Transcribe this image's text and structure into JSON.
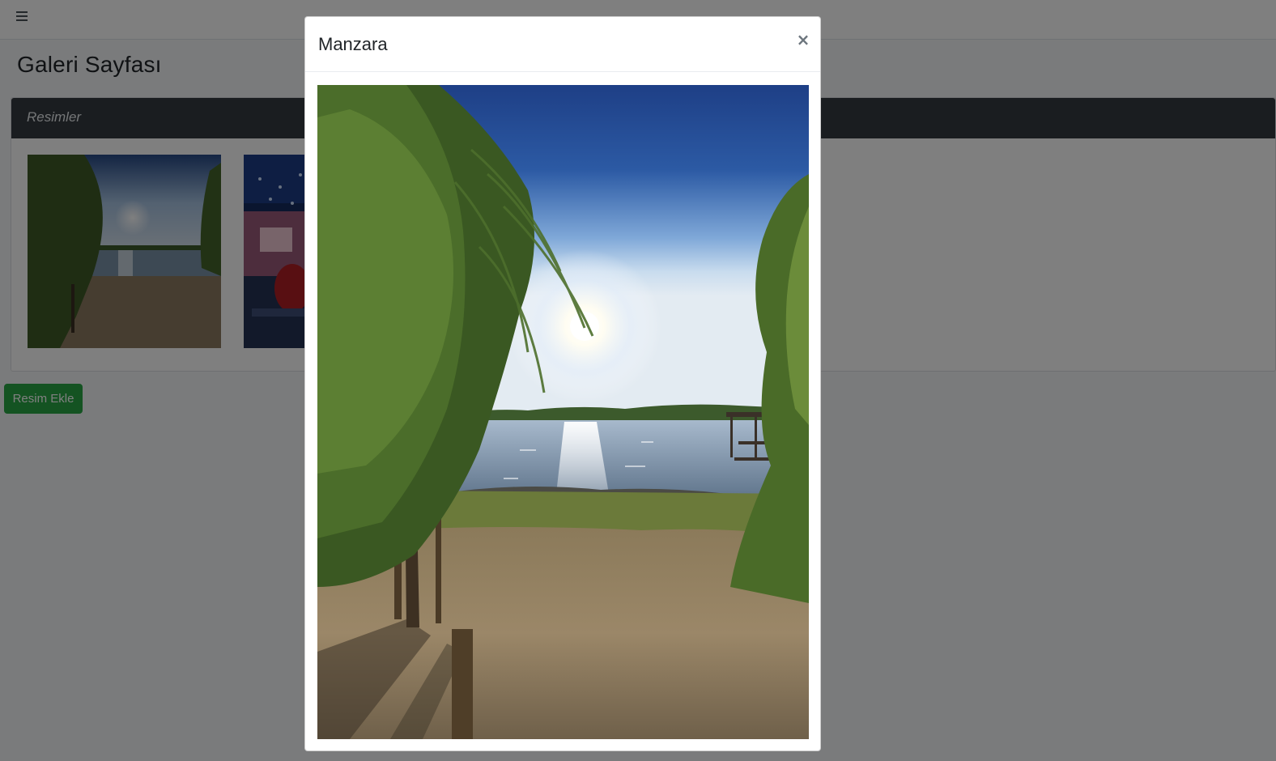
{
  "header": {
    "menu_icon": "hamburger-icon"
  },
  "page": {
    "title": "Galeri Sayfası"
  },
  "gallery": {
    "card_title": "Resimler",
    "add_button_label": "Resim Ekle"
  },
  "modal": {
    "title": "Manzara",
    "close_label": "×",
    "image_description_icon": "landscape-photo"
  },
  "colors": {
    "header_dark": "#343a40",
    "success_green": "#28a745",
    "backdrop": "rgba(0,0,0,0.5)"
  }
}
